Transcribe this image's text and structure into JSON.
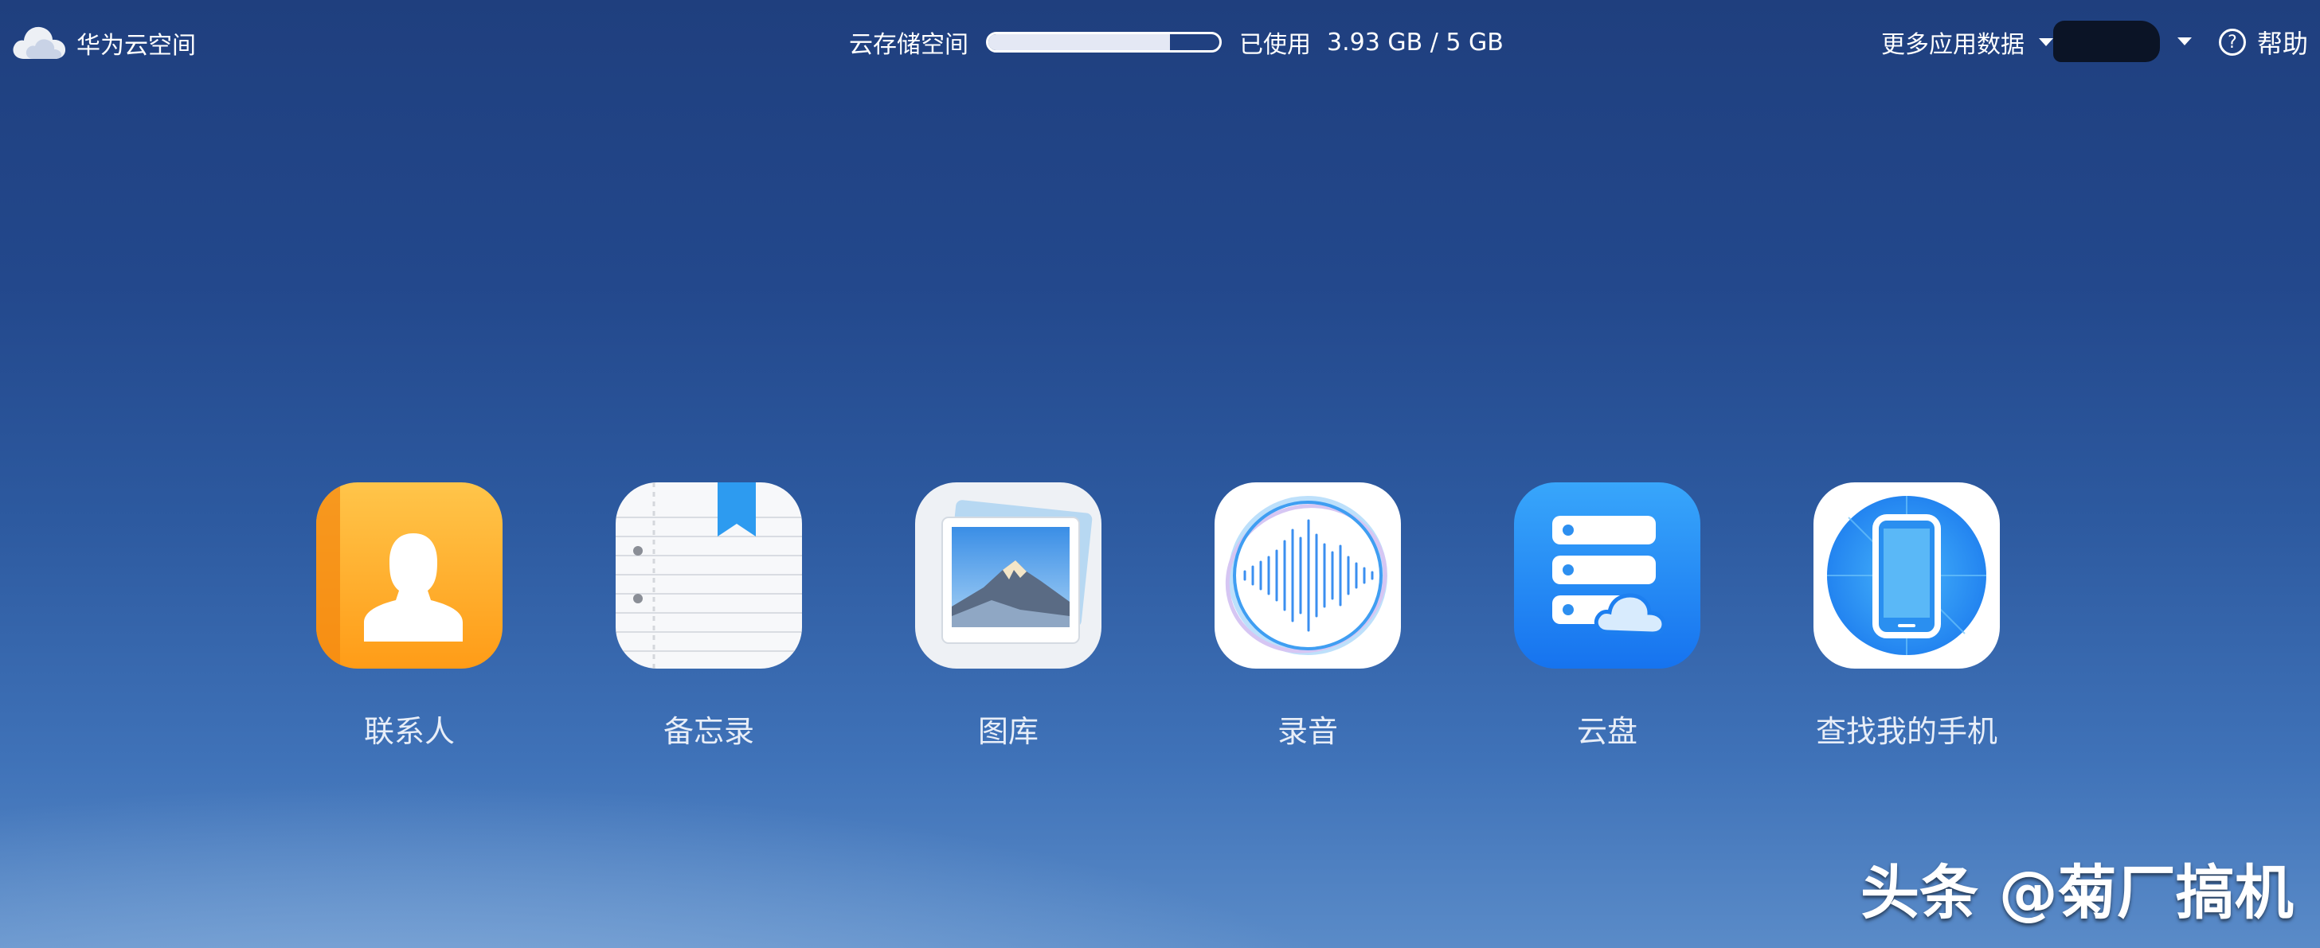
{
  "header": {
    "brand": "华为云空间",
    "storage_label": "云存储空间",
    "storage_used_fraction": 0.786,
    "used_label": "已使用",
    "used_value": "3.93 GB / 5 GB",
    "more_data": "更多应用数据",
    "help": "帮助"
  },
  "apps": [
    {
      "label": "联系人",
      "icon": "contacts-icon"
    },
    {
      "label": "备忘录",
      "icon": "notes-icon"
    },
    {
      "label": "图库",
      "icon": "gallery-icon"
    },
    {
      "label": "录音",
      "icon": "recorder-icon"
    },
    {
      "label": "云盘",
      "icon": "cloud-drive-icon"
    },
    {
      "label": "查找我的手机",
      "icon": "find-phone-icon"
    }
  ],
  "watermark": "头条 @菊厂搞机",
  "colors": {
    "contacts": "#ffa21c",
    "notes_bookmark": "#2d9bf0",
    "cloud_drive": "#1e88f5",
    "find_phone": "#2d8ff0"
  }
}
